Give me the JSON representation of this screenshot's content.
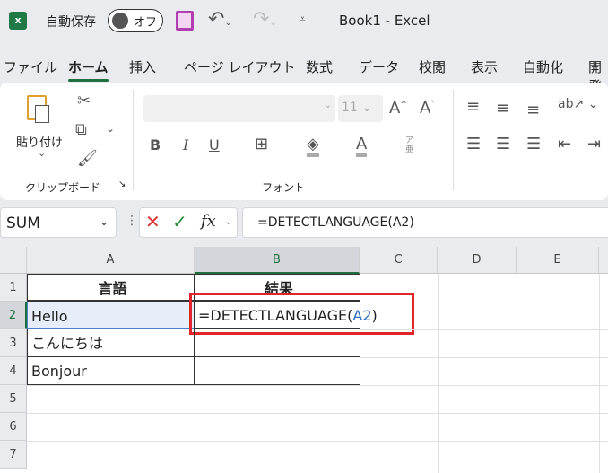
{
  "titlebar": {
    "autosave_label": "自動保存",
    "autosave_state": "オフ",
    "title": "Book1  -  Excel"
  },
  "tabs": [
    {
      "label": "ファイル"
    },
    {
      "label": "ホーム",
      "active": true
    },
    {
      "label": "挿入"
    },
    {
      "label": "ページ レイアウト"
    },
    {
      "label": "数式"
    },
    {
      "label": "データ"
    },
    {
      "label": "校閲"
    },
    {
      "label": "表示"
    },
    {
      "label": "自動化"
    },
    {
      "label": "開発"
    }
  ],
  "ribbon": {
    "paste_label": "貼り付け",
    "clipboard_group": "クリップボード",
    "font_group": "フォント",
    "font_name": "",
    "font_size": "11",
    "bold": "B",
    "italic": "I",
    "underline": "U",
    "font_color": "A",
    "phonetic": "ア亜"
  },
  "formula_bar": {
    "name_box": "SUM",
    "fx": "fx",
    "formula": "=DETECTLANGUAGE(A2)"
  },
  "sheet": {
    "columns": [
      "A",
      "B",
      "C",
      "D",
      "E"
    ],
    "rows": [
      "1",
      "2",
      "3",
      "4",
      "5",
      "6",
      "7"
    ],
    "cells": {
      "A1": "言語",
      "B1": "結果",
      "A2": "Hello",
      "A3": "こんにちは",
      "A4": "Bonjour",
      "B2_prefix": "=DETECTLANGUAGE(",
      "B2_ref": "A2",
      "B2_suffix": ")"
    },
    "ref_color": "#2f6fc2",
    "highlight_color": "#e0262a"
  }
}
